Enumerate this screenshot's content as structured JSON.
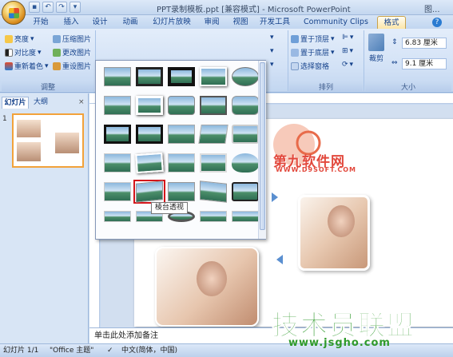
{
  "window": {
    "title": "PPT录制模板.ppt [兼容模式] - Microsoft PowerPoint",
    "right_title_fragment": "图..."
  },
  "tabs": [
    "开始",
    "插入",
    "设计",
    "动画",
    "幻灯片放映",
    "审阅",
    "视图",
    "开发工具",
    "Community Clips",
    "格式"
  ],
  "active_tab": "格式",
  "ribbon": {
    "adjust": {
      "brightness": "亮度",
      "contrast": "对比度",
      "recolor": "重新着色",
      "compress": "压缩图片",
      "change_pic": "更改图片",
      "reset_pic": "重设图片",
      "group_label": "调整"
    },
    "arrange": {
      "bring_front": "置于顶层",
      "send_back": "置于底层",
      "selection_pane": "选择窗格",
      "group_label": "排列"
    },
    "size": {
      "crop": "裁剪",
      "height": "6.83 厘米",
      "width": "9.1 厘米",
      "group_label": "大小"
    }
  },
  "gallery": {
    "selected_index": 21,
    "tooltip": "棱台透视"
  },
  "left_pane": {
    "tab_slides": "幻灯片",
    "tab_outline": "大纲",
    "slide_number": "1"
  },
  "notes_placeholder": "单击此处添加备注",
  "status": {
    "slide_info": "幻灯片 1/1",
    "theme": "\"Office 主题\"",
    "language": "中文(简体，中国)"
  },
  "watermarks": {
    "top_text": "第九软件网",
    "top_url": "WWW.D9SOFT.COM",
    "bottom_text": "技术员联盟",
    "bottom_url": "www.jsgho.com"
  }
}
